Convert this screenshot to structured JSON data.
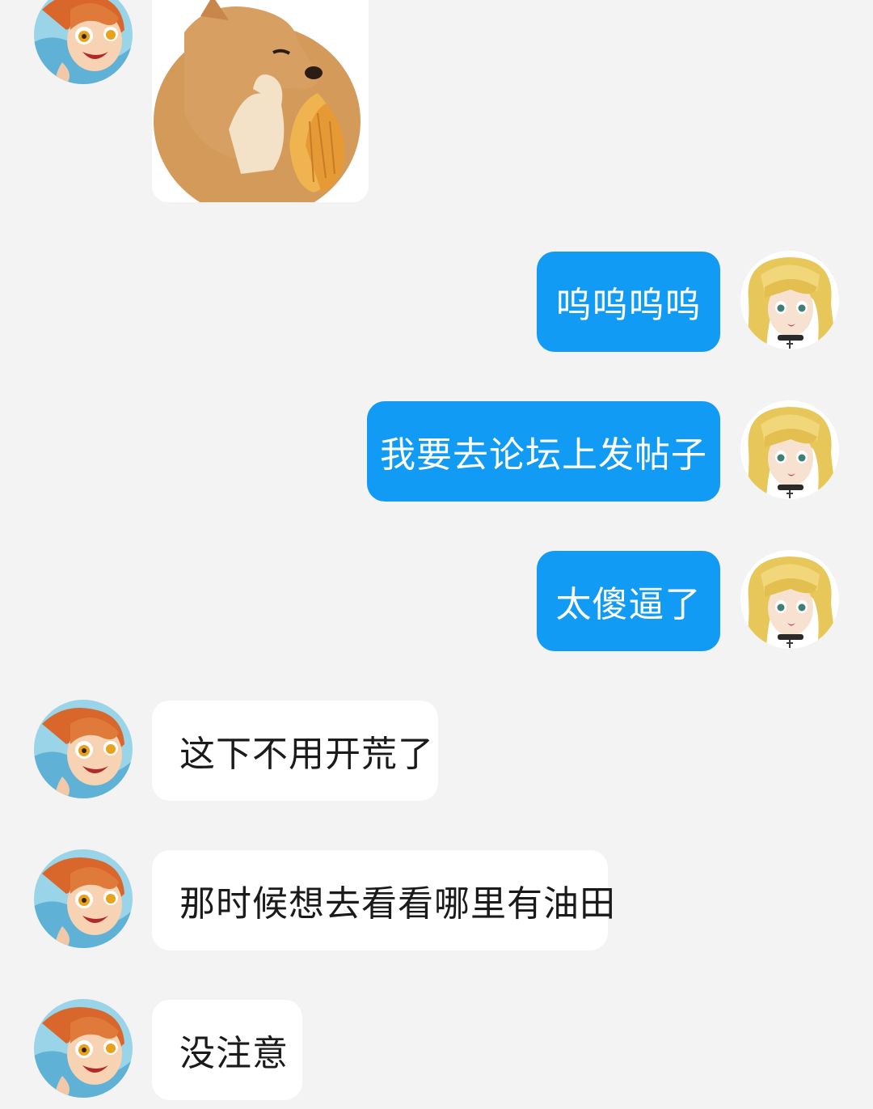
{
  "chat": {
    "sticker": {
      "icon": "doge-praying-sticker"
    },
    "messages": [
      {
        "side": "right",
        "text": "呜呜呜呜"
      },
      {
        "side": "right",
        "text": "我要去论坛上发帖子"
      },
      {
        "side": "right",
        "text": "太傻逼了"
      },
      {
        "side": "left",
        "text": "这下不用开荒了"
      },
      {
        "side": "left",
        "text": "那时候想去看看哪里有油田"
      },
      {
        "side": "left",
        "text": "没注意"
      }
    ]
  },
  "colors": {
    "background": "#f3f3f3",
    "outgoing_bubble": "#129bf5",
    "incoming_bubble": "#ffffff"
  }
}
